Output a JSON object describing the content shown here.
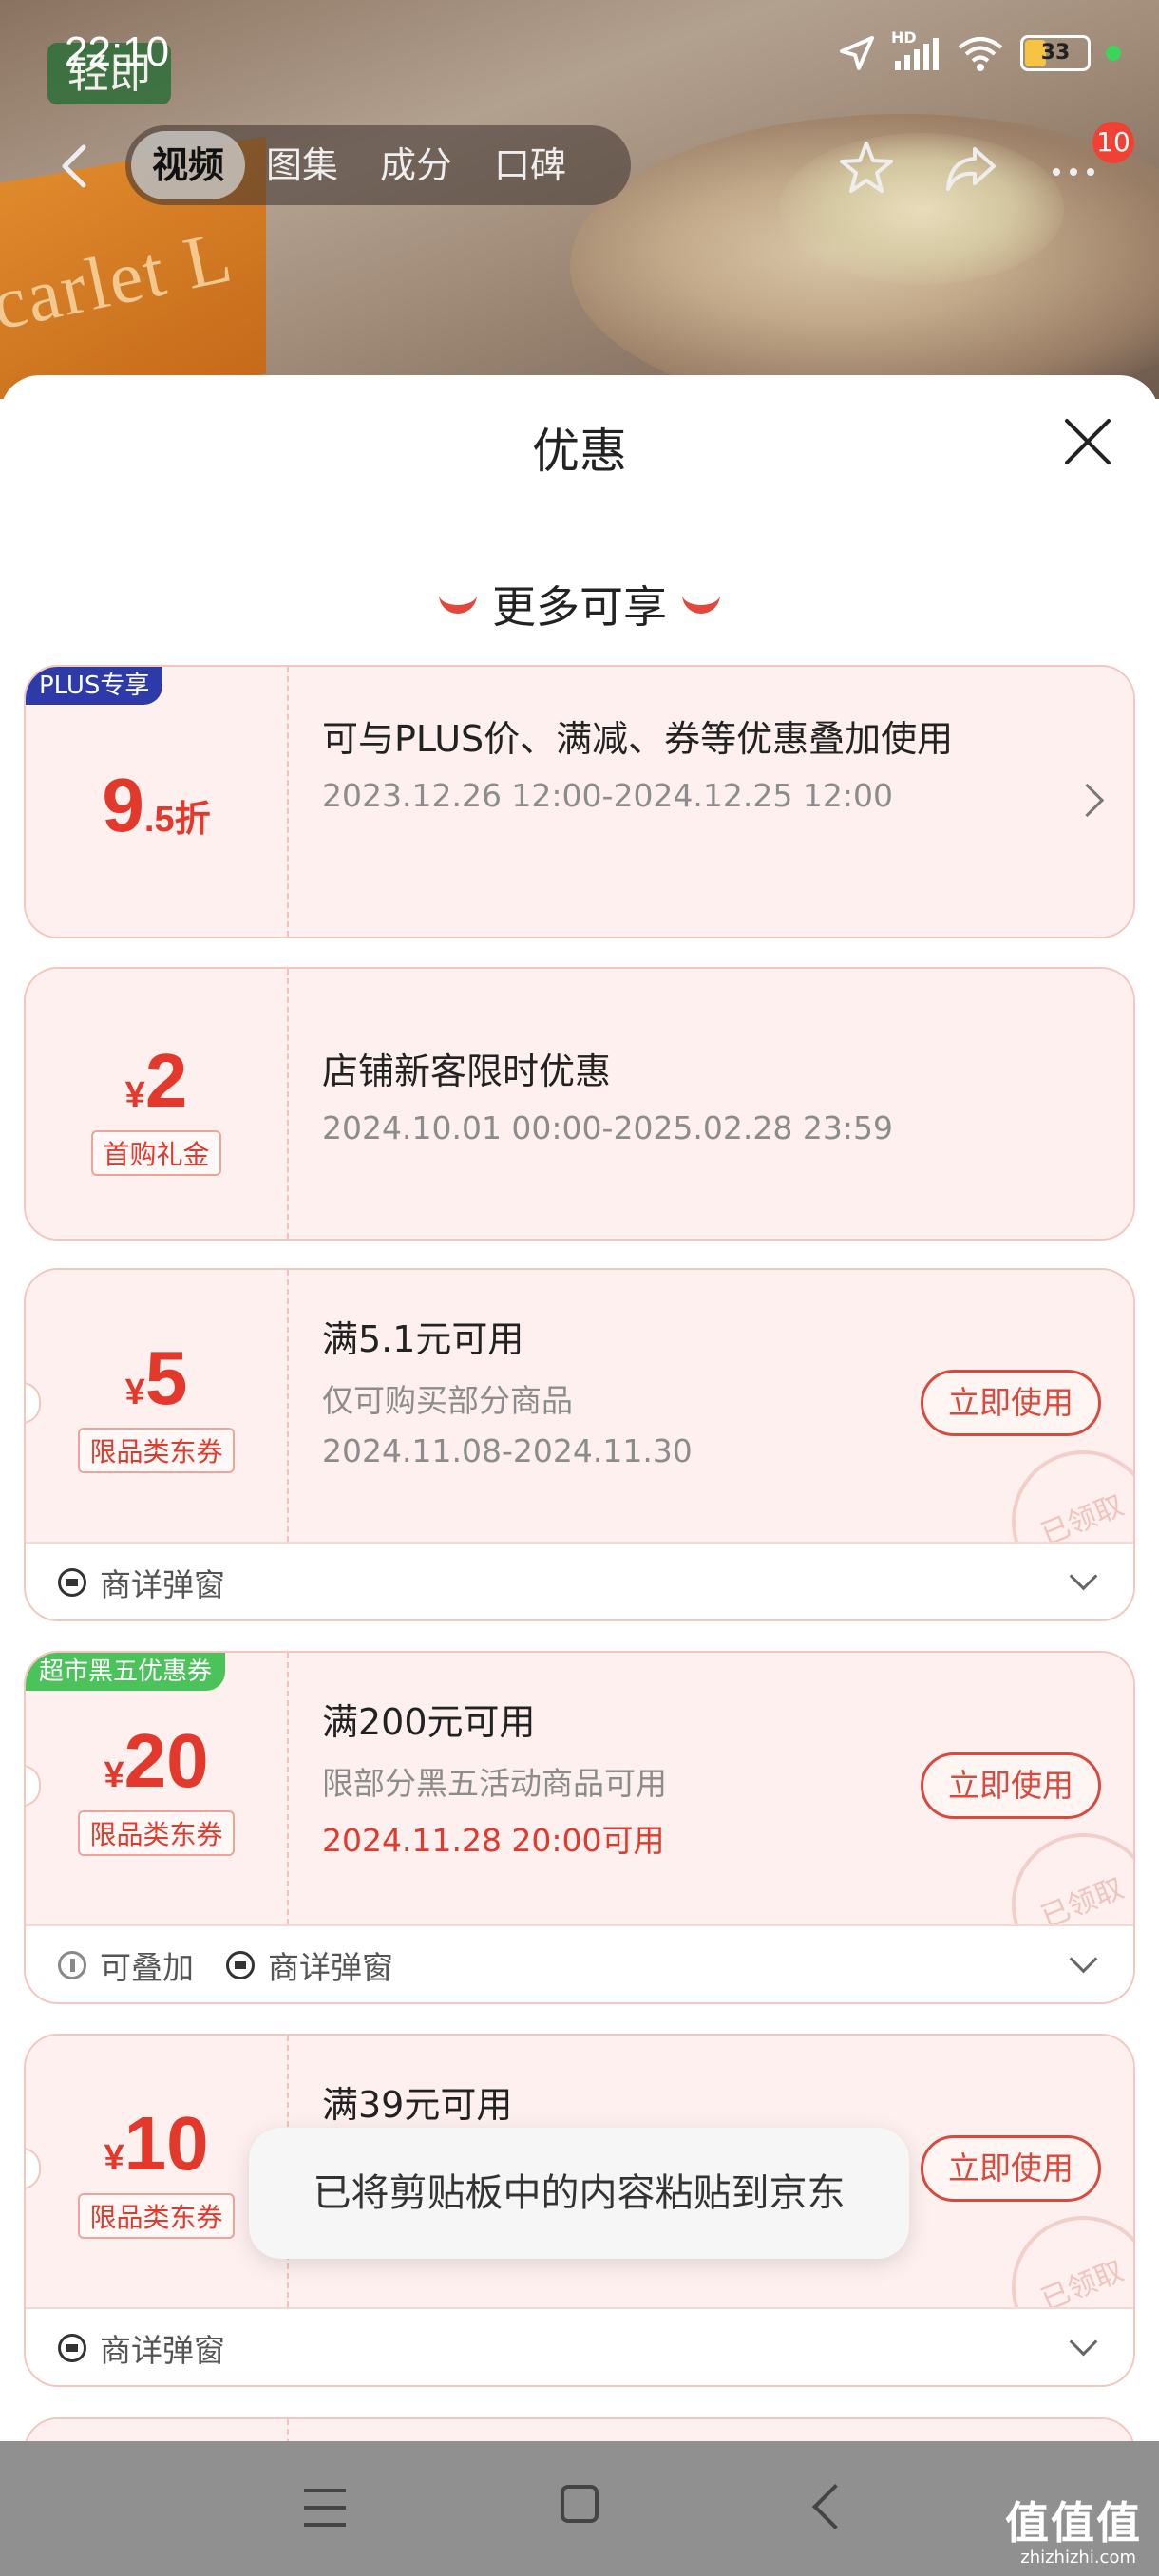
{
  "status_bar": {
    "time": "22:10",
    "network": "HD",
    "battery": "33"
  },
  "nav": {
    "tabs": [
      {
        "label": "视频",
        "active": true
      },
      {
        "label": "图集",
        "active": false
      },
      {
        "label": "成分",
        "active": false
      },
      {
        "label": "口碑",
        "active": false
      }
    ],
    "more_badge": "10"
  },
  "sheet": {
    "title": "优惠",
    "section_header": "更多可享"
  },
  "cards": [
    {
      "corner_tag": "PLUS专享",
      "amount_num": "9",
      "amount_suffix": ".5折",
      "title": "可与PLUS价、满减、券等优惠叠加使用",
      "date": "2023.12.26 12:00-2024.12.25 12:00"
    },
    {
      "amount_currency": "¥",
      "amount_num": "2",
      "stub_label": "首购礼金",
      "title": "店铺新客限时优惠",
      "date": "2024.10.01 00:00-2025.02.28 23:59"
    },
    {
      "amount_currency": "¥",
      "amount_num": "5",
      "stub_label": "限品类东券",
      "title": "满5.1元可用",
      "subtitle": "仅可购买部分商品",
      "date": "2024.11.08-2024.11.30",
      "button": "立即使用",
      "stamp": "已领取",
      "footer": [
        "商详弹窗"
      ]
    },
    {
      "corner_tag": "超市黑五优惠券",
      "amount_currency": "¥",
      "amount_num": "20",
      "stub_label": "限品类东券",
      "title": "满200元可用",
      "subtitle": "限部分黑五活动商品可用",
      "date": "2024.11.28 20:00可用",
      "button": "立即使用",
      "stamp": "已领取",
      "footer": [
        "可叠加",
        "商详弹窗"
      ]
    },
    {
      "amount_currency": "¥",
      "amount_num": "10",
      "stub_label": "限品类东券",
      "title": "满39元可用",
      "button": "立即使用",
      "stamp": "已领取",
      "footer": [
        "商详弹窗"
      ]
    }
  ],
  "toast": "已将剪贴板中的内容粘贴到京东",
  "hero": {
    "box_text": "carlet L",
    "logo_text": "轻即"
  },
  "watermark": {
    "main": "值值值",
    "sub": "zhizhizhi.com"
  },
  "colors": {
    "accent": "#e3392c",
    "plus_tag": "#2e3aa8",
    "black_friday_tag": "#4cc35a",
    "card_bg": "#fdf0ee"
  }
}
